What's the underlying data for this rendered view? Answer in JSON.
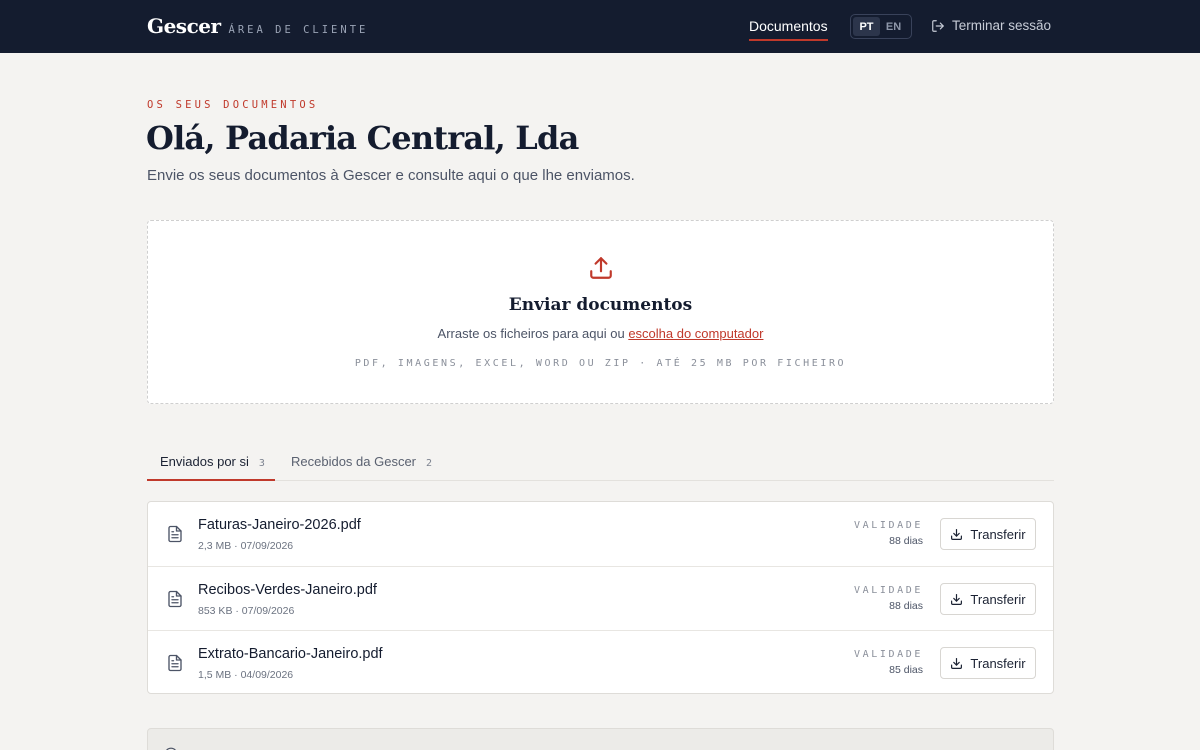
{
  "header": {
    "brand": "Gescer",
    "brand_sub": "ÁREA DE CLIENTE",
    "nav_documents": "Documentos",
    "lang_pt": "PT",
    "lang_en": "EN",
    "logout": "Terminar sessão"
  },
  "intro": {
    "eyebrow": "OS SEUS DOCUMENTOS",
    "greeting": "Olá, Padaria Central, Lda",
    "lede": "Envie os seus documentos à Gescer e consulte aqui o que lhe enviamos."
  },
  "upload": {
    "title": "Enviar documentos",
    "desc_prefix": "Arraste os ficheiros para aqui ou ",
    "desc_link": "escolha do computador",
    "hint": "PDF, IMAGENS, EXCEL, WORD OU ZIP · ATÉ 25 MB POR FICHEIRO"
  },
  "tabs": [
    {
      "label": "Enviados por si",
      "count": "3"
    },
    {
      "label": "Recebidos da Gescer",
      "count": "2"
    }
  ],
  "files": [
    {
      "name": "Faturas-Janeiro-2026.pdf",
      "meta": "2,3 MB · 07/09/2026",
      "validity_label": "VALIDADE",
      "validity": "88 dias",
      "action": "Transferir"
    },
    {
      "name": "Recibos-Verdes-Janeiro.pdf",
      "meta": "853 KB · 07/09/2026",
      "validity_label": "VALIDADE",
      "validity": "88 dias",
      "action": "Transferir"
    },
    {
      "name": "Extrato-Bancario-Janeiro.pdf",
      "meta": "1,5 MB · 04/09/2026",
      "validity_label": "VALIDADE",
      "validity": "85 dias",
      "action": "Transferir"
    }
  ],
  "colors": {
    "accent": "#c0392b",
    "header_bg": "#141c2f",
    "page_bg": "#f4f3f1"
  },
  "icons": [
    "logout-icon",
    "upload-icon",
    "document-icon",
    "download-icon",
    "info-icon"
  ]
}
